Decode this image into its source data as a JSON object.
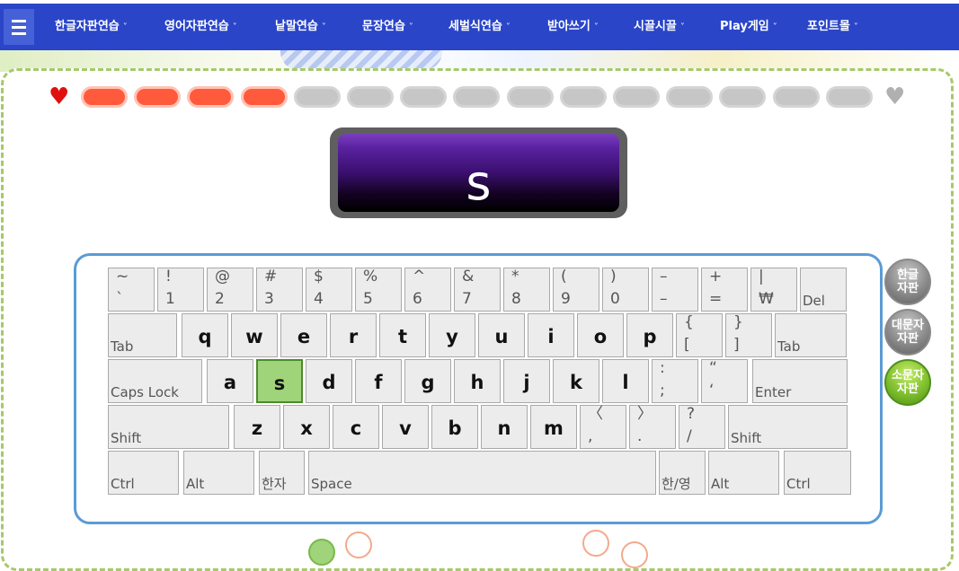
{
  "nav": {
    "items": [
      "한글자판연습",
      "영어자판연습",
      "낱말연습",
      "문장연습",
      "세벌식연습",
      "받아쓰기",
      "시끌시끌",
      "Play게임",
      "포인트몰"
    ],
    "chevron": "˅"
  },
  "progress": {
    "total": 15,
    "completed": 4,
    "heart_icon": "♥"
  },
  "target": {
    "char": "s"
  },
  "keyboard": {
    "row1": [
      {
        "t": "~",
        "b": "`"
      },
      {
        "t": "!",
        "b": "1"
      },
      {
        "t": "@",
        "b": "2"
      },
      {
        "t": "#",
        "b": "3"
      },
      {
        "t": "$",
        "b": "4"
      },
      {
        "t": "%",
        "b": "5"
      },
      {
        "t": "^",
        "b": "6"
      },
      {
        "t": "&",
        "b": "7"
      },
      {
        "t": "*",
        "b": "8"
      },
      {
        "t": "(",
        "b": "9"
      },
      {
        "t": ")",
        "b": "0"
      },
      {
        "t": "–",
        "b": "–"
      },
      {
        "t": "+",
        "b": "="
      },
      {
        "t": "|",
        "b": "₩"
      },
      {
        "label": "Del"
      }
    ],
    "row2": [
      "q",
      "w",
      "e",
      "r",
      "t",
      "y",
      "u",
      "i",
      "o",
      "p"
    ],
    "row2_sym": [
      {
        "t": "{",
        "b": "["
      },
      {
        "t": "}",
        "b": "]"
      }
    ],
    "row3": [
      "a",
      "s",
      "d",
      "f",
      "g",
      "h",
      "j",
      "k",
      "l"
    ],
    "row3_sym": [
      {
        "t": ":",
        "b": ";"
      },
      {
        "t": "“",
        "b": "‘"
      }
    ],
    "row4": [
      "z",
      "x",
      "c",
      "v",
      "b",
      "n",
      "m"
    ],
    "row4_sym": [
      {
        "t": "〈",
        "b": ","
      },
      {
        "t": "〉",
        "b": "."
      },
      {
        "t": "?",
        "b": "/"
      }
    ],
    "labels": {
      "tab": "Tab",
      "caps": "Caps Lock",
      "enter": "Enter",
      "shift": "Shift",
      "ctrl": "Ctrl",
      "alt": "Alt",
      "hanja": "한자",
      "space": "Space",
      "hanyoung": "한/영"
    },
    "highlight": "s"
  },
  "modes": [
    {
      "label": "한글 자판",
      "active": false
    },
    {
      "label": "대문자 자판",
      "active": false
    },
    {
      "label": "소문자 자판",
      "active": true
    }
  ],
  "colors": {
    "nav": "#2a45c8",
    "progress_on": "#ff5a3c",
    "progress_off": "#c6c6c6",
    "highlight": "#9fd47a",
    "frame": "#a6c96b",
    "keyboard_border": "#5b9bd5"
  }
}
